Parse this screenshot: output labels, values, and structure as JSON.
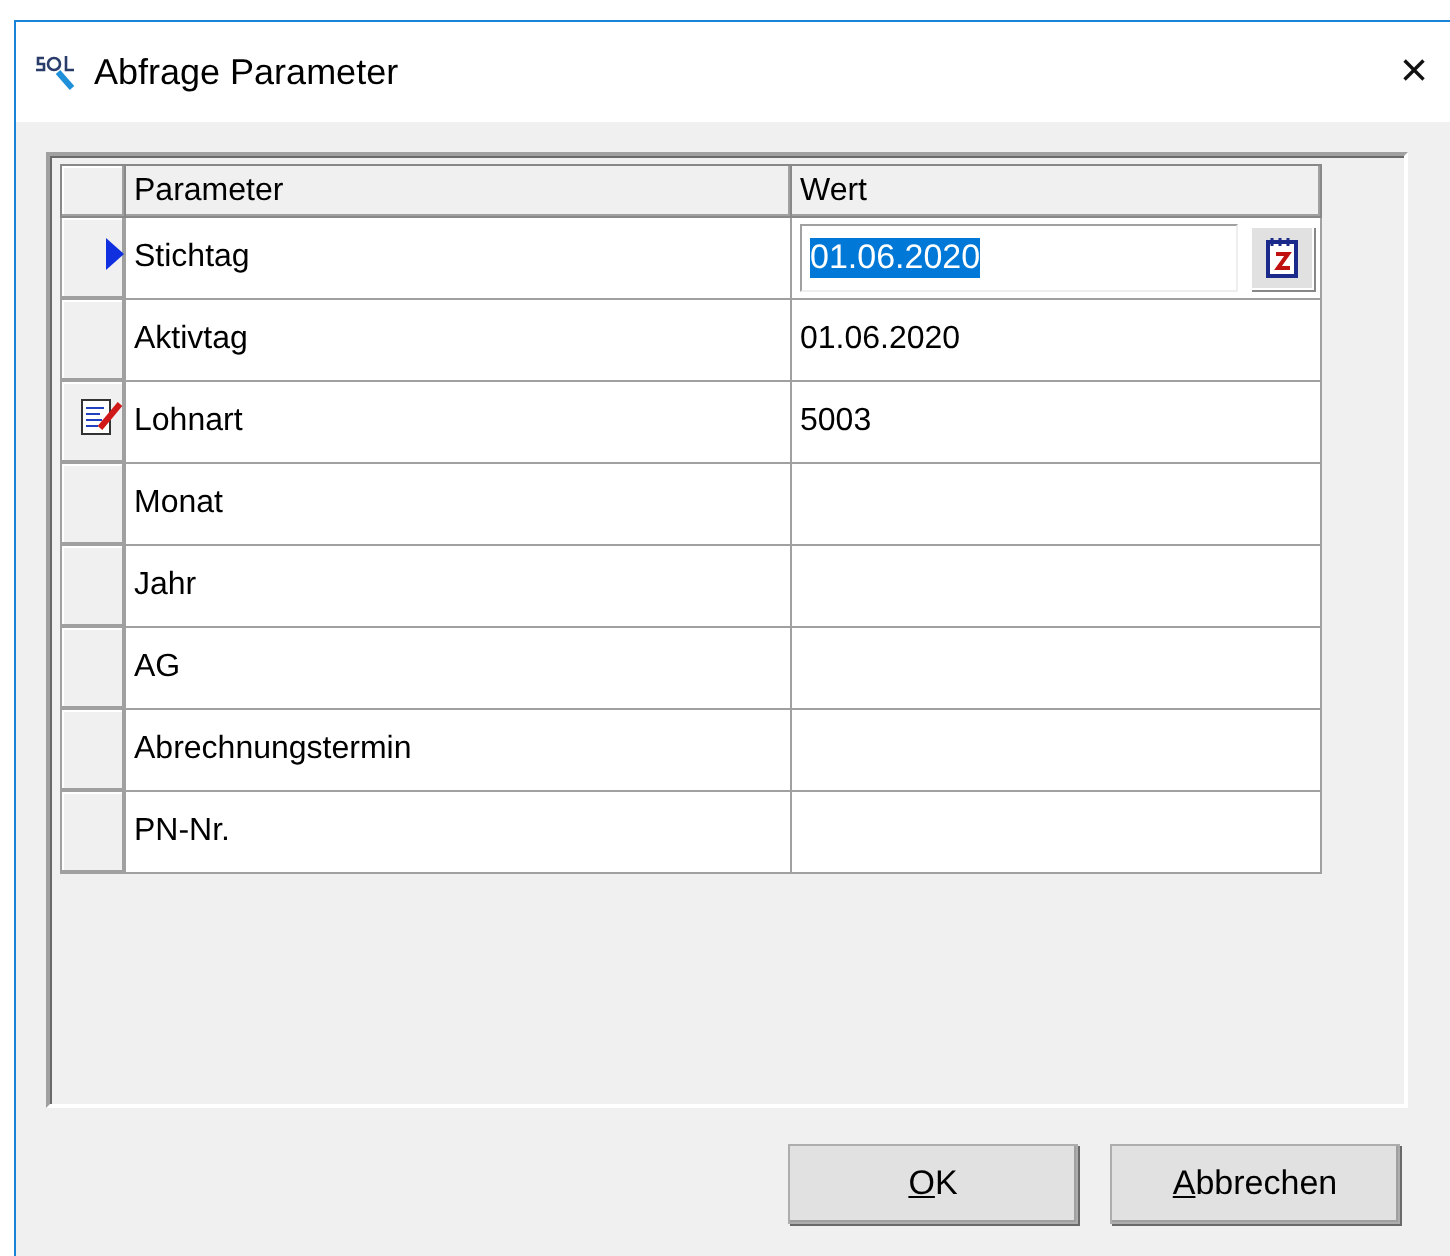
{
  "window": {
    "title": "Abfrage Parameter",
    "close": "×"
  },
  "grid": {
    "columns": [
      "Parameter",
      "Wert"
    ],
    "rows": [
      {
        "parameter": "Stichtag",
        "value": "01.06.2020",
        "kind": "current",
        "editing": true
      },
      {
        "parameter": "Aktivtag",
        "value": "01.06.2020",
        "kind": "plain",
        "editing": false
      },
      {
        "parameter": "Lohnart",
        "value": "5003",
        "kind": "edit",
        "editing": false
      },
      {
        "parameter": "Monat",
        "kind": "plain",
        "editing": false
      },
      {
        "parameter": "Jahr",
        "kind": "plain",
        "editing": false
      },
      {
        "parameter": "AG",
        "kind": "plain",
        "editing": false
      },
      {
        "parameter": "Abrechnungstermin",
        "kind": "plain",
        "editing": false
      },
      {
        "parameter": "PN-Nr.",
        "kind": "plain",
        "editing": false
      }
    ]
  },
  "buttons": [
    "OK",
    "Abbrechen"
  ]
}
